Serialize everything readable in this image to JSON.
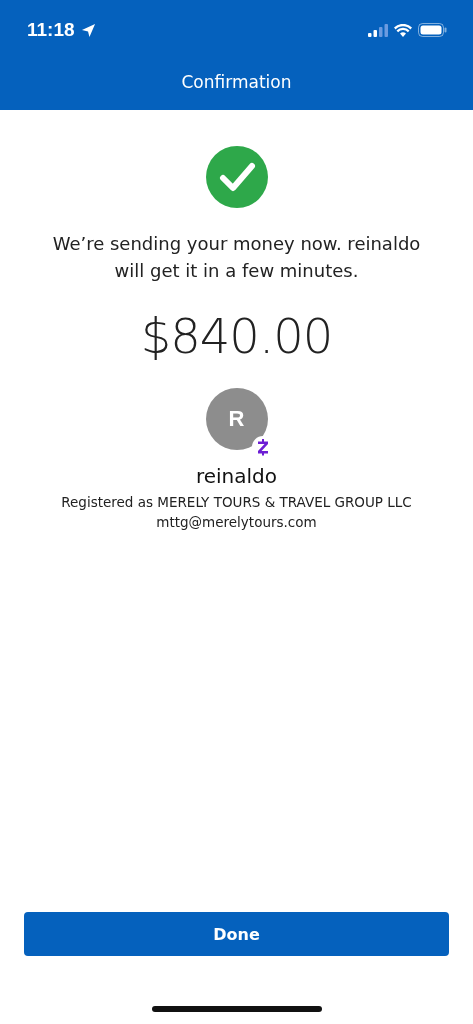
{
  "status_bar": {
    "time": "11:18"
  },
  "header": {
    "title": "Confirmation"
  },
  "message": "We’re sending your money now. reinaldo will get it in a few minutes.",
  "amount": "$840.00",
  "recipient": {
    "initial": "R",
    "name": "reinaldo",
    "registered": "Registered as MERELY TOURS & TRAVEL GROUP LLC",
    "email": "mttg@merelytours.com"
  },
  "buttons": [
    "Done"
  ]
}
